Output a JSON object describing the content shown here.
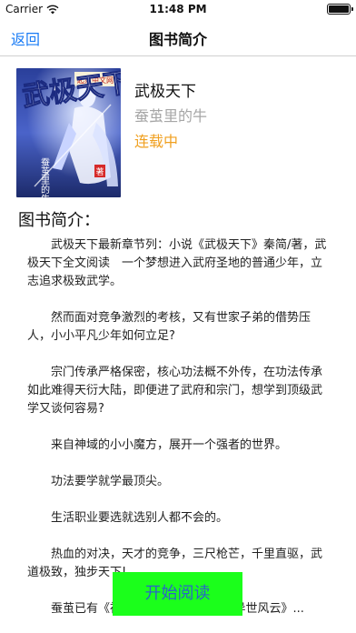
{
  "status_bar": {
    "carrier": "Carrier",
    "time": "11:48 PM"
  },
  "nav": {
    "back_label": "返回",
    "title": "图书简介"
  },
  "book": {
    "cover_title": "武极天下",
    "cover_author": "蚕茧里的牛",
    "cover_author_suffix": "著",
    "cover_publisher": "起点中文网",
    "title": "武极天下",
    "author": "蚕茧里的牛",
    "status": "连载中"
  },
  "section_title": "图书简介：",
  "intro": {
    "paragraphs": [
      "武极天下最新章节列：小说《武极天下》秦简/著，武极天下全文阅读　一个梦想进入武府圣地的普通少年，立志追求极致武学。",
      "然而面对竞争激烈的考核，又有世家子弟的借势压人，小小平凡少年如何立足?",
      "宗门传承严格保密，核心功法概不外传，在功法传承如此难得天衍大陆，即便进了武府和宗门，想学到顶级武学又谈何容易?",
      "来自神域的小小魔方，展开一个强者的世界。",
      "功法要学就学最顶尖。",
      "生活职业要选就选别人都不会的。",
      "热血的对决，天才的竞争，三尺枪芒，千里直驱，武道极致，独步天下!",
      "蚕茧已有《神偷化身》《魔兽多塔之异世风云》..."
    ]
  },
  "start_button": {
    "label": "开始阅读"
  },
  "colors": {
    "link": "#1a7cf5",
    "status": "#f0a020",
    "author": "#a6a6a6",
    "button_bg": "#1bff1b",
    "button_text": "#2a64c8"
  },
  "icons": [
    "wifi-icon",
    "battery-icon"
  ]
}
